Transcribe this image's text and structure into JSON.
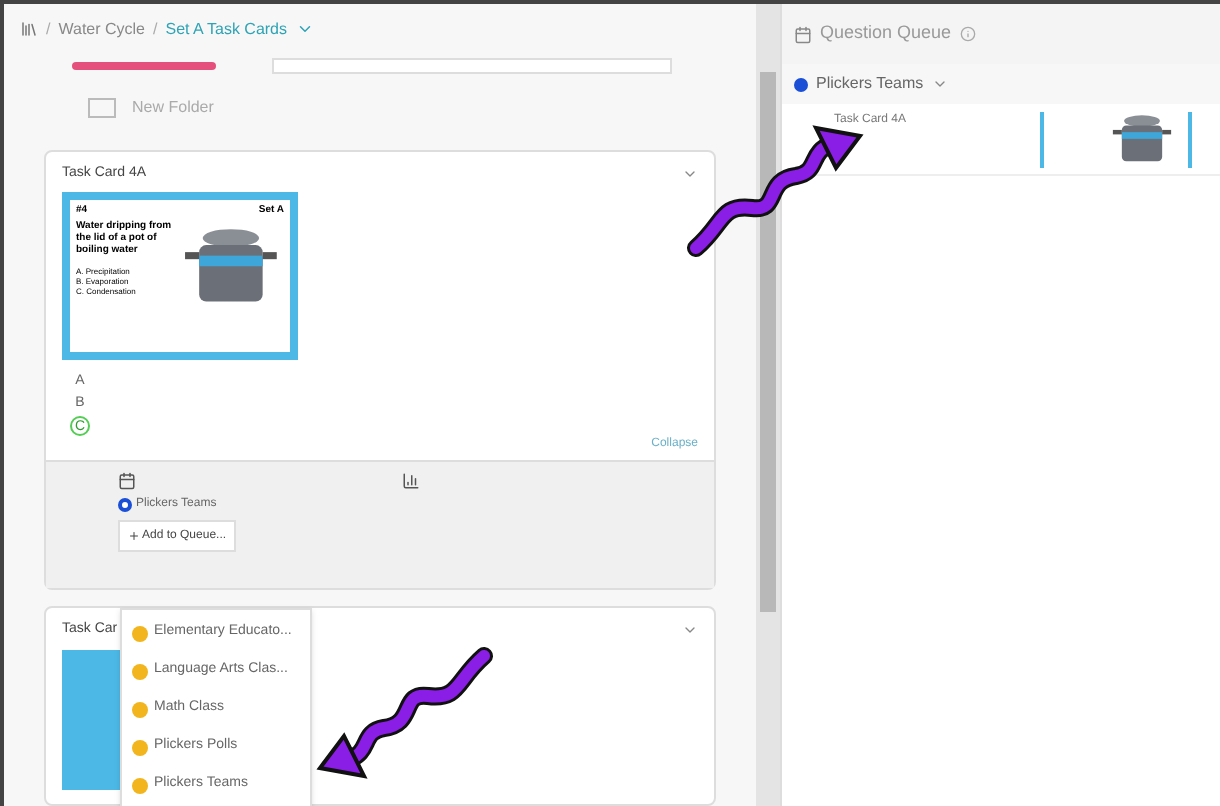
{
  "breadcrumb": {
    "separator": "/",
    "items": [
      {
        "label": "Water Cycle",
        "selected": false
      },
      {
        "label": "Set A Task Cards",
        "selected": true
      }
    ]
  },
  "new_folder": "New Folder",
  "cards": [
    {
      "title": "Task Card 4A",
      "card_image": {
        "number": "#4",
        "set": "Set A",
        "question": "Water dripping from the lid of a pot of boiling water",
        "options": [
          "A. Precipitation",
          "B. Evaporation",
          "C. Condensation"
        ]
      },
      "answers": [
        {
          "label": "A",
          "correct": false
        },
        {
          "label": "B",
          "correct": false
        },
        {
          "label": "C",
          "correct": true
        }
      ],
      "collapse": "Collapse",
      "section": {
        "label": "Plickers Teams",
        "selected": true
      },
      "add_button": "Add to Queue...",
      "menu": [
        {
          "label": "Elementary Educato..."
        },
        {
          "label": "Language Arts Clas..."
        },
        {
          "label": "Math Class"
        },
        {
          "label": "Plickers Polls"
        },
        {
          "label": "Plickers Teams"
        }
      ]
    },
    {
      "title": "Task Car"
    }
  ],
  "queue": {
    "title": "Question Queue",
    "section": {
      "label": "Plickers Teams",
      "color": "#1a4fd6"
    },
    "items": [
      {
        "title": "Task Card 4A"
      }
    ]
  }
}
